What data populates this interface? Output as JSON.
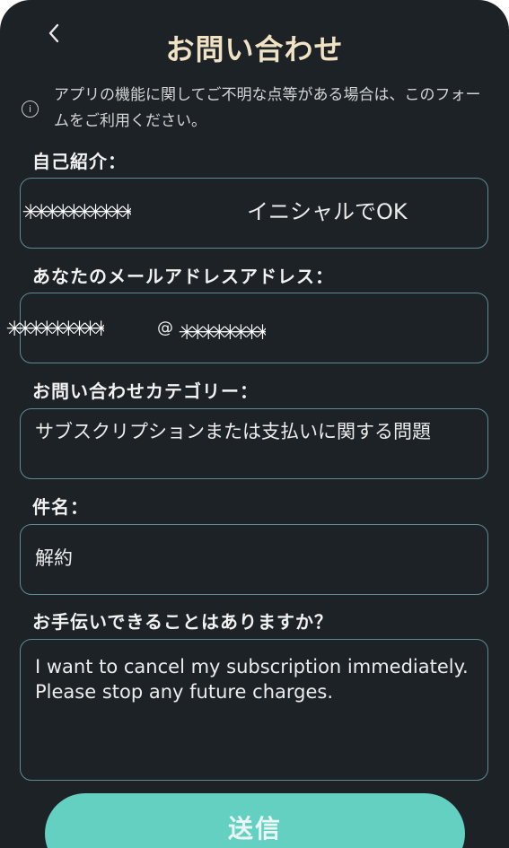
{
  "header": {
    "back_icon": "chevron-left-icon",
    "title": "お問い合わせ"
  },
  "info": {
    "icon": "info-icon",
    "text": "アプリの機能に関してご不明な点等がある場合は、このフォームをご利用ください。"
  },
  "intro": {
    "label": "自己紹介：",
    "value": "イニシャルでOK",
    "redacted": "✳✳✳✳✳✳✳✳✳✳"
  },
  "email": {
    "label": "あなたのメールアドレスアドレス：",
    "at_sign": "@",
    "redacted_user": "✳✳✳✳✳✳✳✳✳",
    "redacted_domain": "✳✳✳✳✳✳✳✳"
  },
  "category": {
    "label": "お問い合わせカテゴリー：",
    "value": "サブスクリプションまたは支払いに関する問題"
  },
  "subject": {
    "label": "件名：",
    "value": "解約"
  },
  "message": {
    "label": "お手伝いできることはありますか？",
    "value": "I want to cancel my subscription immediately.\nPlease stop any future charges."
  },
  "submit": {
    "label": "送信"
  },
  "colors": {
    "background": "#1d2227",
    "title": "#efe3c4",
    "field_border": "#5f8a93",
    "button": "#63d0c1"
  }
}
